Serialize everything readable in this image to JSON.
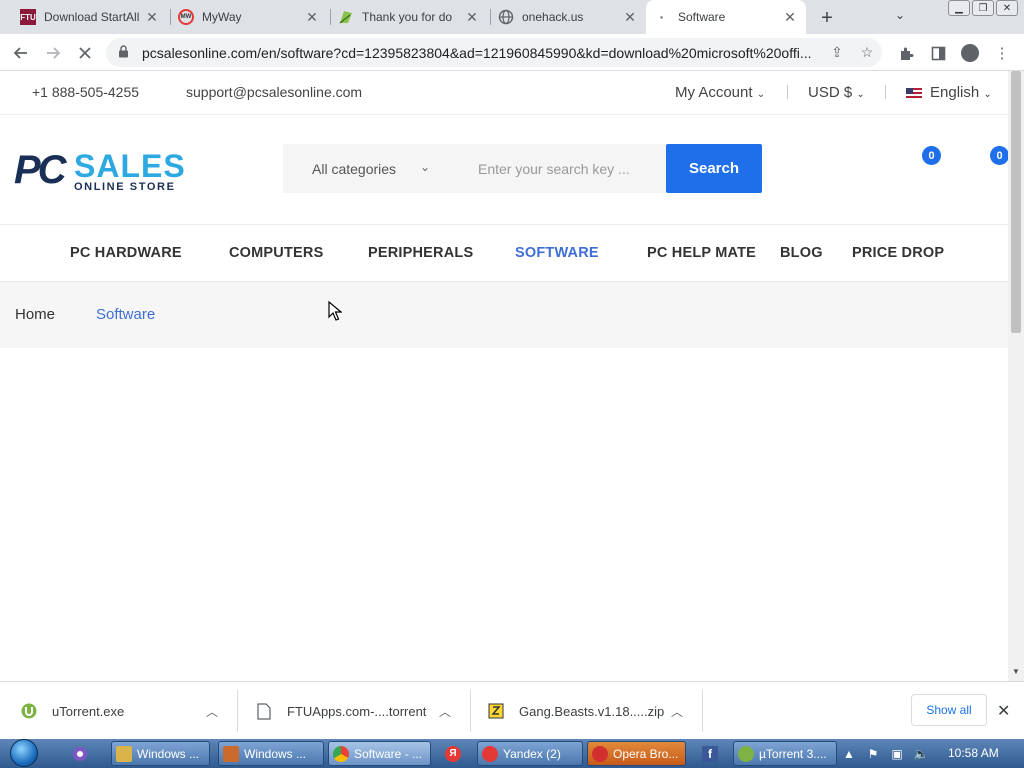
{
  "browser": {
    "tabs": [
      {
        "title": "Download StartAll",
        "favicon": "FTU",
        "favicon_color": "#8b1a3a"
      },
      {
        "title": "MyWay",
        "favicon": "MW",
        "favicon_color": "#e53935"
      },
      {
        "title": "Thank you for do",
        "favicon": "",
        "favicon_color": "#8bc34a"
      },
      {
        "title": "onehack.us",
        "favicon": "",
        "favicon_color": "#5f6368"
      },
      {
        "title": "Software",
        "favicon": "",
        "favicon_color": "#5f6368"
      }
    ],
    "active_tab_index": 4,
    "url": "pcsalesonline.com/en/software?cd=12395823804&ad=121960845990&kd=download%20microsoft%20offi..."
  },
  "site": {
    "topbar": {
      "phone": "+1 888-505-4255",
      "email": "support@pcsalesonline.com",
      "account": "My Account",
      "currency": "USD $",
      "language": "English"
    },
    "logo": {
      "pc": "PC",
      "sales": "SALES",
      "tagline": "ONLINE STORE"
    },
    "search": {
      "category": "All categories",
      "placeholder": "Enter your search key ...",
      "button": "Search"
    },
    "badges": {
      "wishlist": "0",
      "cart": "0"
    },
    "nav": [
      "PC HARDWARE",
      "COMPUTERS",
      "PERIPHERALS",
      "SOFTWARE",
      "PC HELP MATE",
      "BLOG",
      "PRICE DROP"
    ],
    "nav_active": "SOFTWARE",
    "breadcrumb": {
      "home": "Home",
      "current": "Software"
    },
    "colors": {
      "accent": "#1f6fea",
      "link": "#3f6fd6",
      "logo_dark": "#1a2f55",
      "logo_light": "#2da9e1"
    }
  },
  "downloads": {
    "items": [
      {
        "name": "uTorrent.exe",
        "icon": "utorrent-icon"
      },
      {
        "name": "FTUApps.com-....torrent",
        "icon": "file-icon"
      },
      {
        "name": "Gang.Beasts.v1.18.....zip",
        "icon": "zip-icon"
      }
    ],
    "show_all": "Show all"
  },
  "taskbar": {
    "buttons": [
      {
        "label": "Windows ...",
        "color": "#d9b44a"
      },
      {
        "label": "Windows ...",
        "color": "#c96b2c"
      },
      {
        "label": "Software - ...",
        "color": "#4caf50"
      },
      {
        "label": "Yandex (2)",
        "color": "#e53935"
      },
      {
        "label": "Opera Bro...",
        "color": "#d32f2f"
      },
      {
        "label": "µTorrent 3....",
        "color": "#7cb342"
      }
    ],
    "clock": "10:58 AM"
  }
}
